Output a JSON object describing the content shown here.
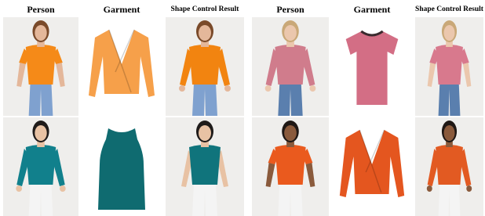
{
  "headers": [
    "Person",
    "Garment",
    "Shape Control Result",
    "Person",
    "Garment",
    "Shape Control Result"
  ],
  "rows": [
    [
      {
        "name": "person-orange-tee",
        "kind": "person",
        "top": "#f58a18",
        "bottom": "#7fa1cf",
        "skin": "#e4b79a",
        "hair": "#7a4a2a",
        "sleeve": "short"
      },
      {
        "name": "garment-orange-wrap",
        "kind": "garment",
        "top": "#f6a04a",
        "style": "wrap-long"
      },
      {
        "name": "result-orange-wrap",
        "kind": "person",
        "top": "#f28410",
        "bottom": "#7fa1cf",
        "skin": "#e4b79a",
        "hair": "#7a4a2a",
        "sleeve": "long"
      },
      {
        "name": "person-pink-tee",
        "kind": "person",
        "top": "#d07c8c",
        "bottom": "#5a7fae",
        "skin": "#ebc7ad",
        "hair": "#c9a878",
        "sleeve": "long"
      },
      {
        "name": "garment-pink-tee",
        "kind": "garment",
        "top": "#d36e85",
        "style": "tee"
      },
      {
        "name": "result-pink-tee",
        "kind": "person",
        "top": "#d8798d",
        "bottom": "#5a7fae",
        "skin": "#ebc7ad",
        "hair": "#c9a878",
        "sleeve": "short"
      }
    ],
    [
      {
        "name": "person-teal-longsleeve",
        "kind": "person",
        "top": "#11808c",
        "bottom": "#f4f4f4",
        "skin": "#e8c2a4",
        "hair": "#1f1b1a",
        "sleeve": "long"
      },
      {
        "name": "garment-teal-tank",
        "kind": "garment",
        "top": "#0f6b70",
        "style": "tank"
      },
      {
        "name": "result-teal-tank",
        "kind": "person",
        "top": "#10747c",
        "bottom": "#f4f4f4",
        "skin": "#e8c2a4",
        "hair": "#1f1b1a",
        "sleeve": "none"
      },
      {
        "name": "person-orange-tee-2",
        "kind": "person",
        "top": "#ea5a1e",
        "bottom": "#f4f4f4",
        "skin": "#8a5a3c",
        "hair": "#1f1815",
        "sleeve": "short"
      },
      {
        "name": "garment-orange-wrap-2",
        "kind": "garment",
        "top": "#e4561f",
        "style": "wrap-long"
      },
      {
        "name": "result-orange-wrap-2",
        "kind": "person",
        "top": "#e25a22",
        "bottom": "#f4f4f4",
        "skin": "#8a5a3c",
        "hair": "#1f1815",
        "sleeve": "long"
      }
    ]
  ]
}
